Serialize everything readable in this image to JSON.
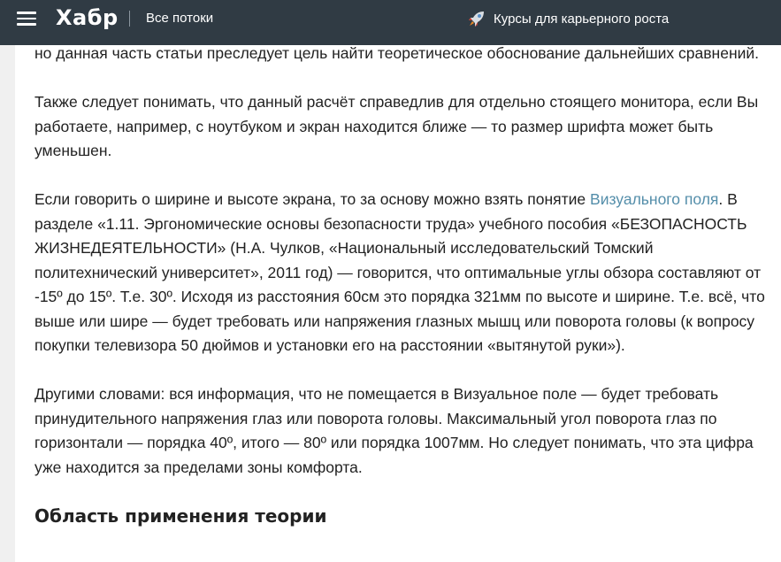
{
  "header": {
    "logo": "Хабр",
    "flows_label": "Все потоки",
    "courses_label": "Курсы для карьерного роста",
    "bg_color": "#303b44"
  },
  "article": {
    "paragraphs": [
      {
        "text": "но данная часть статьи преследует цель найти теоретическое обоснование дальнейших сравнений."
      },
      {
        "text": "Также следует понимать, что данный расчёт справедлив для отдельно стоящего монитора, если Вы работаете, например, с ноутбуком и экран находится ближе — то размер шрифта может быть уменьшен."
      },
      {
        "before_link": "Если говорить о ширине и высоте экрана, то за основу можно взять понятие ",
        "link": "Визуального поля",
        "after_link": ". В разделе «1.11. Эргономические основы безопасности труда» учебного пособия «БЕЗОПАСНОСТЬ ЖИЗНЕДЕЯТЕЛЬНОСТИ» (Н.А. Чулков, «Национальный исследовательский Томский политехнический университет», 2011 год) — говорится, что оптимальные углы обзора составляют от -15º до 15º. Т.е. 30º. Исходя из расстояния 60см это порядка 321мм по высоте и ширине. Т.е. всё, что выше или шире — будет требовать или напряжения глазных мышц или поворота головы (к вопросу покупки телевизора 50 дюймов и установки его на расстоянии «вытянутой руки»)."
      },
      {
        "text": "Другими словами: вся информация, что не помещается в Визуальное поле — будет требовать принудительного напряжения глаз или поворота головы. Максимальный угол поворота глаз по горизонтали — порядка 40º, итого — 80º или порядка 1007мм. Но следует понимать, что эта цифра уже находится за пределами зоны комфорта."
      }
    ],
    "heading": "Область применения теории",
    "link_color": "#548eaa"
  },
  "icons": {
    "menu": "hamburger-menu-icon",
    "rocket": "rocket-icon"
  }
}
